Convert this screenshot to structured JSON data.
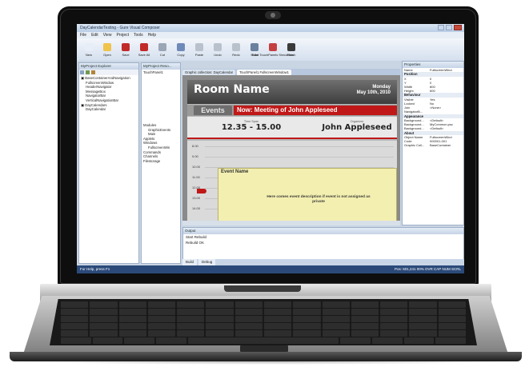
{
  "window": {
    "title": "DayCalendarTesting - Gure Visual Composer"
  },
  "menu": [
    "File",
    "Edit",
    "View",
    "Project",
    "Tools",
    "Help"
  ],
  "toolbar": [
    {
      "label": "New",
      "icon": "new-file-icon",
      "color": "#e7eef8"
    },
    {
      "label": "Open",
      "icon": "open-folder-icon",
      "color": "#f0c34a"
    },
    {
      "label": "Save",
      "icon": "save-icon",
      "color": "#c22a2a"
    },
    {
      "label": "Save All",
      "icon": "save-all-icon",
      "color": "#c22a2a"
    },
    {
      "label": "Cut",
      "icon": "cut-icon",
      "color": "#9aa6b6"
    },
    {
      "label": "Copy",
      "icon": "copy-icon",
      "color": "#6f89b8"
    },
    {
      "label": "Paste",
      "icon": "paste-icon",
      "color": "#b9c2cc"
    },
    {
      "label": "Undo",
      "icon": "undo-icon",
      "color": "#b9c2cc"
    },
    {
      "label": "Redo",
      "icon": "redo-icon",
      "color": "#b9c2cc"
    },
    {
      "label": "Build",
      "icon": "build-icon",
      "color": "#6b7f9e"
    },
    {
      "label": "Start TouchPanels Simulation",
      "icon": "simulation-icon",
      "color": "#c44040"
    },
    {
      "label": "Finish",
      "icon": "finish-flag-icon",
      "color": "#3a3a3a"
    }
  ],
  "explorer": {
    "title": "MyProject Explorer",
    "items": [
      "BaseContainerAndNavigation",
      "FullscreenWindow",
      "HeaderNavigator",
      "MessageBox",
      "NavigatorBar",
      "VerticalNavigationBar",
      "DayCalendars",
      "DayCalendar"
    ]
  },
  "resources": {
    "title": "MyProject Reso...",
    "top_item": "TouchPanel1",
    "items": [
      "Modules",
      "GraphicEvents",
      "Main",
      "Applets",
      "Windows",
      "FullscreenWin",
      "Commands",
      "Channels",
      "Filestorage"
    ]
  },
  "tabs": [
    "Graphic collection: DayCalendar",
    "TouchPanel1.FullscreenWindow1"
  ],
  "room": {
    "name": "Room Name",
    "day": "Monday",
    "date": "May 10th, 2010",
    "events_label": "Events",
    "now_text": "Now: Meeting of John Appleseed",
    "time_span_label": "Time Span",
    "time_span": "12.35 - 15.00",
    "organizer_label": "Organizer",
    "organizer": "John Appleseed",
    "times": [
      "8.00",
      "9.00",
      "10.00",
      "11.00",
      "12.00",
      "13.00",
      "14.00"
    ],
    "event_name": "Event Name",
    "event_desc": "Here comes event description if event is not assigned as private"
  },
  "properties": {
    "title": "Properties",
    "rows": [
      {
        "k": "Name",
        "v": "FullscreenWind"
      },
      {
        "cat": "Position"
      },
      {
        "k": "X",
        "v": "0"
      },
      {
        "k": "Y",
        "v": "0"
      },
      {
        "k": "Width",
        "v": "800"
      },
      {
        "k": "Height",
        "v": "600"
      },
      {
        "cat": "Behaviour"
      },
      {
        "k": "Visible",
        "v": "Yes"
      },
      {
        "k": "Locked",
        "v": "No"
      },
      {
        "k": "Join",
        "v": "<None>"
      },
      {
        "k": "NavigatorB...",
        "v": ""
      },
      {
        "cat": "Appearance"
      },
      {
        "k": "Background...",
        "v": "<Default>"
      },
      {
        "k": "Background...",
        "v": "MyCommon.psc"
      },
      {
        "k": "Background...",
        "v": "<Default>"
      },
      {
        "cat": "About"
      },
      {
        "k": "Object Name",
        "v": "FullscreenWind"
      },
      {
        "k": "Code",
        "v": "000001-001"
      },
      {
        "k": "Graphic Coll...",
        "v": "BaseContainer"
      }
    ]
  },
  "output": {
    "title": "Output",
    "lines": [
      "Start Rebuild",
      "Rebuild OK"
    ],
    "tabs": [
      "Build",
      "Debug"
    ]
  },
  "status": {
    "left": "For Help, press F1",
    "right": "Pos: 601,241  00%      OVR CAP NUM SCRL"
  }
}
